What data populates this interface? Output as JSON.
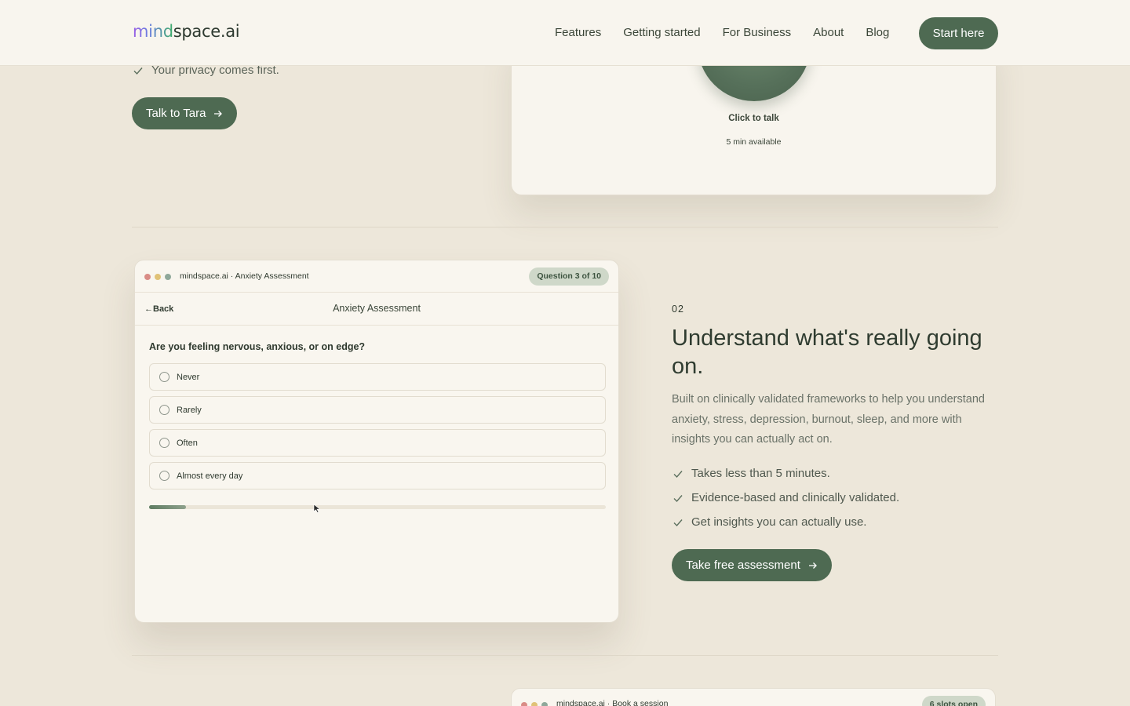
{
  "nav": {
    "logo_prefix": "mind",
    "logo_suffix": "space.ai",
    "links": [
      "Features",
      "Getting started",
      "For Business",
      "About",
      "Blog"
    ],
    "cta": "Start here"
  },
  "hero": {
    "check_text": "Your privacy comes first.",
    "button": "Talk to Tara",
    "card": {
      "orb_label": "Click to talk",
      "orb_sub": "5 min available"
    }
  },
  "assessment_window": {
    "title": "mindspace.ai · Anxiety Assessment",
    "badge": "Question 3 of 10",
    "back": "Back",
    "header_title": "Anxiety Assessment",
    "question": "Are you feeling nervous, anxious, or on edge?",
    "options": [
      "Never",
      "Rarely",
      "Often",
      "Almost every day"
    ],
    "progress_fraction": 0.08,
    "dot_colors": [
      "#d98c86",
      "#e0c277",
      "#8fa89a"
    ]
  },
  "feature": {
    "number": "02",
    "title": "Understand what's really going on.",
    "description": "Built on clinically validated frameworks to help you understand anxiety, stress, depression, burnout, sleep, and more with insights you can actually act on.",
    "checks": [
      "Takes less than 5 minutes.",
      "Evidence-based and clinically validated.",
      "Get insights you can actually use."
    ],
    "button": "Take free assessment"
  },
  "booking_window": {
    "title": "mindspace.ai · Book a session",
    "badge": "6 slots open"
  },
  "colors": {
    "accent": "#4e6a52",
    "background": "#ede7da",
    "surface": "#f8f5ee"
  }
}
